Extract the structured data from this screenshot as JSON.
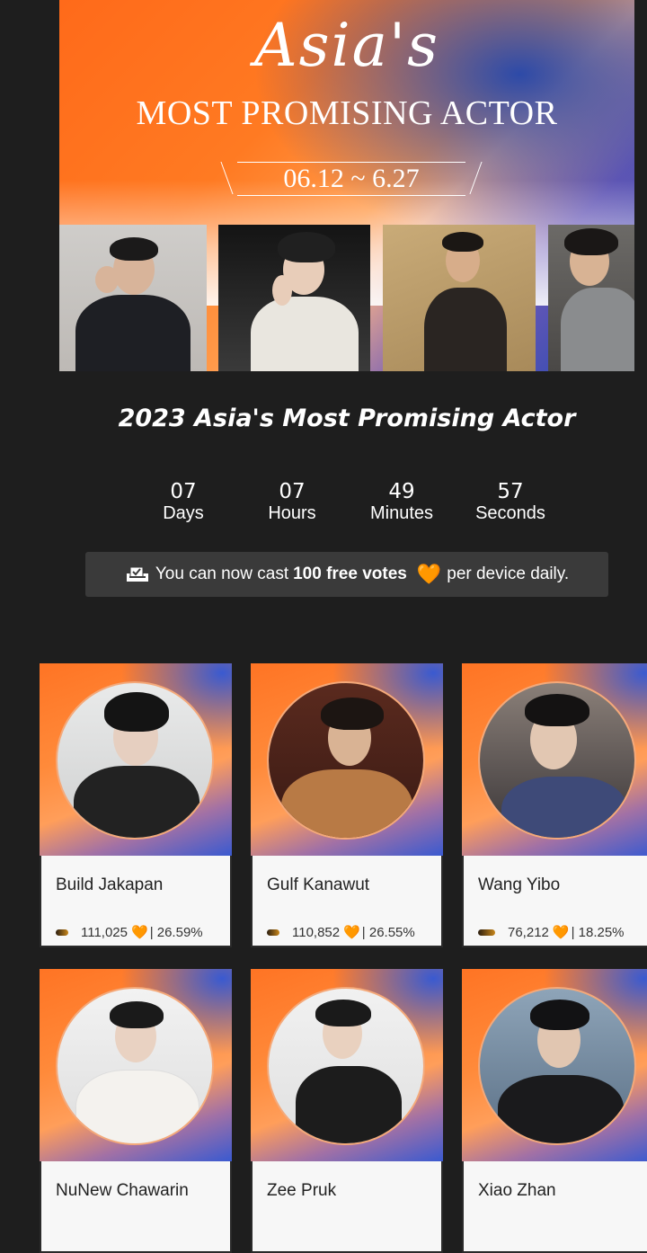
{
  "banner": {
    "script_title": "Asia's",
    "main_title": "MOST PROMISING ACTOR",
    "dates": "06.12 ~ 6.27"
  },
  "section_title": "2023 Asia's Most Promising Actor",
  "countdown": [
    {
      "value": "07",
      "label": "Days"
    },
    {
      "value": "07",
      "label": "Hours"
    },
    {
      "value": "49",
      "label": "Minutes"
    },
    {
      "value": "57",
      "label": "Seconds"
    }
  ],
  "notice": {
    "prefix": "You can now cast",
    "bold": "100 free votes",
    "suffix": "per device daily.",
    "heart": "🧡",
    "icon": "ballot-box-icon"
  },
  "candidates": [
    {
      "name": "Build Jakapan",
      "votes": "111,025",
      "percent": "| 26.59%",
      "share": 0.2659
    },
    {
      "name": "Gulf Kanawut",
      "votes": "110,852",
      "percent": "| 26.55%",
      "share": 0.2655
    },
    {
      "name": "Wang Yibo",
      "votes": "76,212",
      "percent": "| 18.25%",
      "share": 0.1825
    },
    {
      "name": "NuNew Chawarin",
      "votes": "",
      "percent": "",
      "share": null
    },
    {
      "name": "Zee Pruk",
      "votes": "",
      "percent": "",
      "share": null
    },
    {
      "name": "Xiao Zhan",
      "votes": "",
      "percent": "",
      "share": null
    }
  ],
  "colors": {
    "accent_orange": "#ff7424",
    "accent_blue": "#2849b0",
    "heart": "#ff9a1f",
    "page_bg": "#1e1e1e"
  }
}
